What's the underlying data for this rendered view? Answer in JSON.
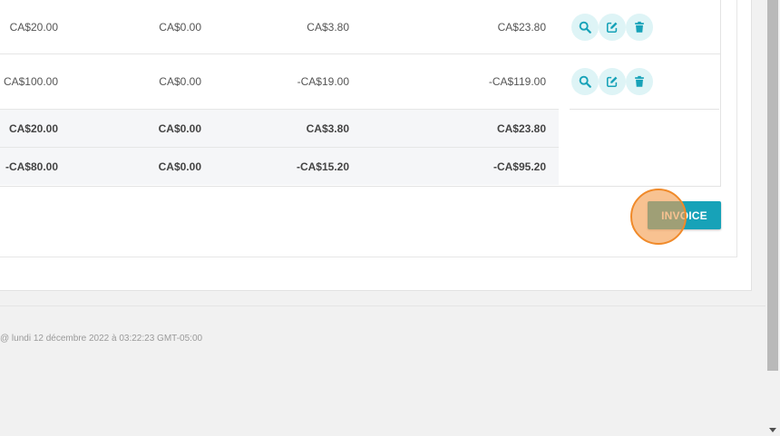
{
  "colors": {
    "accent": "#17a2b8",
    "action_icon": "#17a2b8",
    "action_bg": "#def4f6",
    "total_row_bg": "#f5f6f8",
    "click_marker": "#f39d4e"
  },
  "table": {
    "rows": [
      {
        "c1": "CA$20.00",
        "c2": "CA$0.00",
        "c3": "CA$3.80",
        "c4": "CA$23.80"
      },
      {
        "c1": "CA$100.00",
        "c2": "CA$0.00",
        "c3": "-CA$19.00",
        "c4": "-CA$119.00"
      }
    ],
    "totals": [
      {
        "c1": "CA$20.00",
        "c2": "CA$0.00",
        "c3": "CA$3.80",
        "c4": "CA$23.80"
      },
      {
        "c1": "-CA$80.00",
        "c2": "CA$0.00",
        "c3": "-CA$15.20",
        "c4": "-CA$95.20"
      }
    ],
    "row_actions": [
      "search-icon",
      "edit-icon",
      "trash-icon"
    ]
  },
  "invoice_button": {
    "label": "INVOICE"
  },
  "footer": {
    "text": "@ lundi 12 décembre 2022 à 03:22:23 GMT-05:00"
  }
}
